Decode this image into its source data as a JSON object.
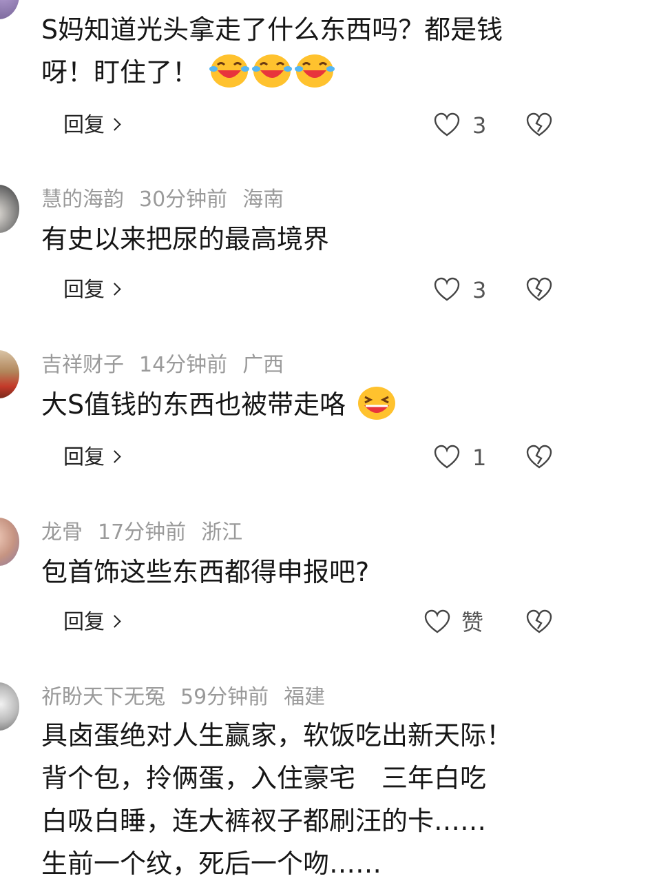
{
  "comments": [
    {
      "user": "",
      "time": "",
      "location": "",
      "text_lines": [
        "S妈知道光头拿走了什么东西吗？都是钱",
        "呀！盯住了！"
      ],
      "emojis": [
        "laugh-cry-emoji",
        "laugh-cry-emoji",
        "laugh-cry-emoji"
      ],
      "reply_label": "回复",
      "likes": "3"
    },
    {
      "user": "慧的海韵",
      "time": "30分钟前",
      "location": "海南",
      "text_lines": [
        "有史以来把尿的最高境界"
      ],
      "emojis": [],
      "reply_label": "回复",
      "likes": "3"
    },
    {
      "user": "吉祥财子",
      "time": "14分钟前",
      "location": "广西",
      "text_lines": [
        "大S值钱的东西也被带走咯"
      ],
      "emojis": [
        "grin-emoji"
      ],
      "reply_label": "回复",
      "likes": "1"
    },
    {
      "user": "龙骨",
      "time": "17分钟前",
      "location": "浙江",
      "text_lines": [
        "包首饰这些东西都得申报吧?"
      ],
      "emojis": [],
      "reply_label": "回复",
      "likes": "赞"
    },
    {
      "user": "祈盼天下无冤",
      "time": "59分钟前",
      "location": "福建",
      "text_lines": [
        "具卤蛋绝对人生赢家，软饭吃出新天际！",
        "背个包，拎俩蛋，入住豪宅　三年白吃",
        "白吸白睡，连大裤衩子都刷汪的卡……",
        "生前一个纹，死后一个吻……"
      ],
      "emojis": [],
      "reply_label": "",
      "likes": ""
    }
  ],
  "colors": {
    "meta_text": "#9a9a9a",
    "body_text": "#161616",
    "icon_stroke": "#444444",
    "emoji_face": "#ffc22e",
    "emoji_mouth": "#e8343c"
  }
}
